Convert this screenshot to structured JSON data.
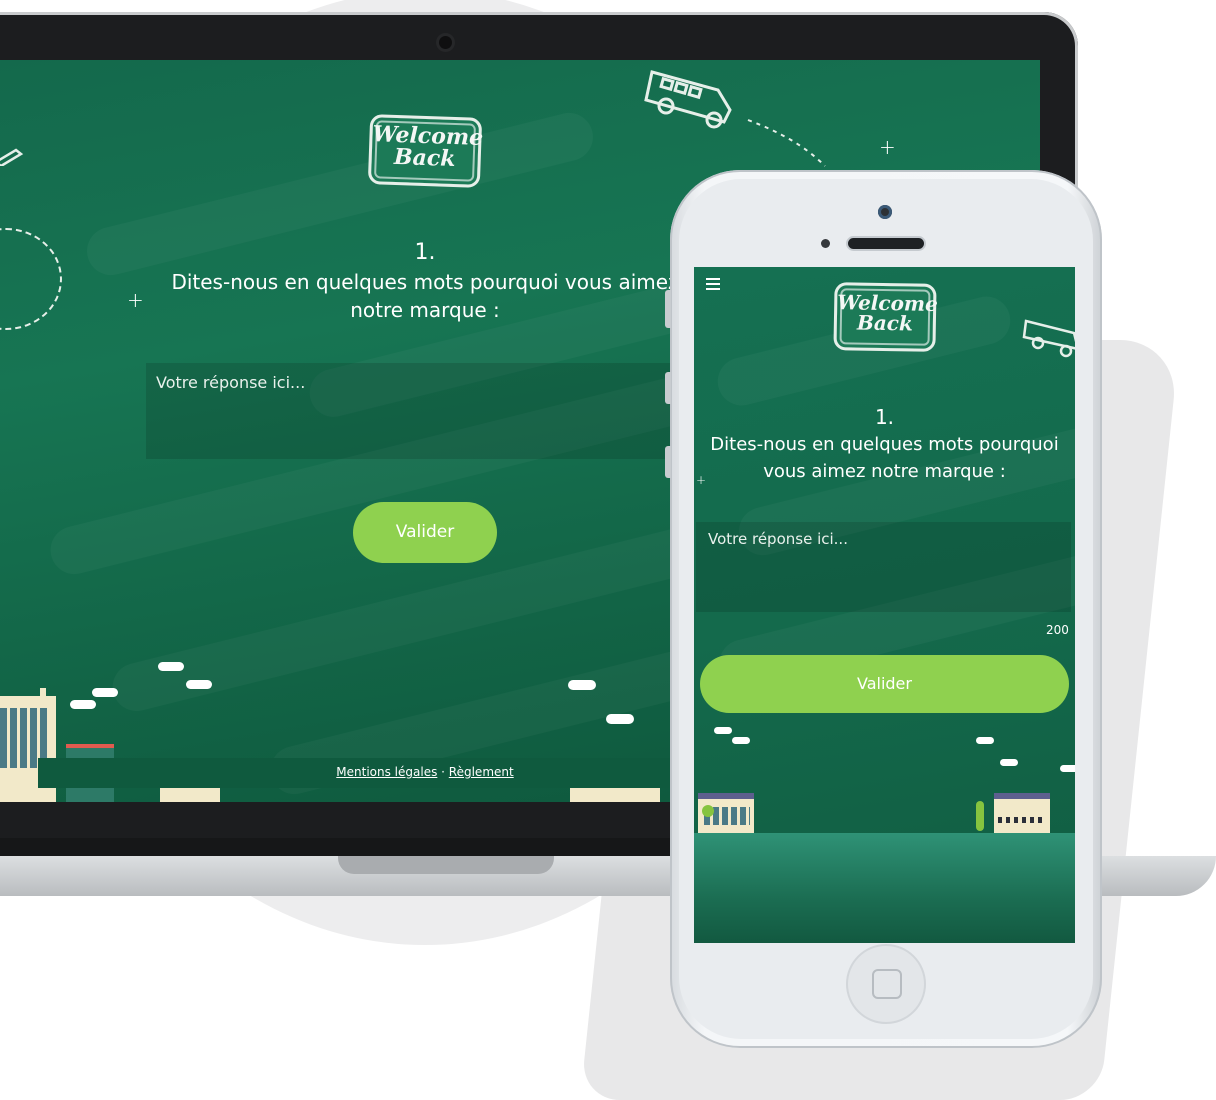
{
  "brand": {
    "sign_line1": "Welcome",
    "sign_line2": "Back"
  },
  "question": {
    "number": "1.",
    "text": "Dites-nous en quelques mots pourquoi vous aimez notre marque :"
  },
  "answer": {
    "placeholder": "Votre réponse ici...",
    "char_counter": "200"
  },
  "submit_label": "Valider",
  "footer": {
    "mentions": "Mentions légales",
    "separator": " · ",
    "reglement": "Règlement"
  },
  "colors": {
    "chalkboard": "#177553",
    "button": "#8fd14f"
  },
  "icons": {
    "menu": "hamburger-menu-icon",
    "bus": "school-bus-icon",
    "pencil": "pencil-icon"
  }
}
